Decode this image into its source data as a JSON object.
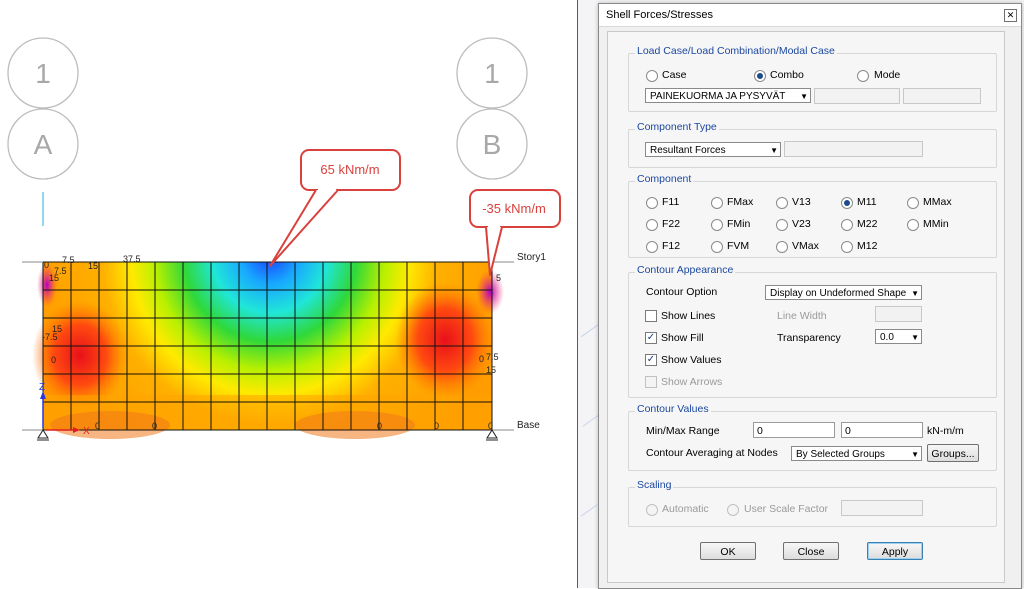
{
  "viewport": {
    "grid_bubbles": [
      {
        "id": "bubble-1-left",
        "text": "1"
      },
      {
        "id": "bubble-a",
        "text": "A"
      },
      {
        "id": "bubble-1-right",
        "text": "1"
      },
      {
        "id": "bubble-b",
        "text": "B"
      }
    ],
    "callouts": {
      "center": "65 kNm/m",
      "right": "-35 kNm/m"
    },
    "story_labels": {
      "top": "Story1",
      "bottom": "Base"
    },
    "contour_values": [
      {
        "text": "0"
      },
      {
        "text": "7.5"
      },
      {
        "text": "7.5"
      },
      {
        "text": "15"
      },
      {
        "text": "15"
      },
      {
        "text": "37.5"
      },
      {
        "text": "15"
      },
      {
        "text": "-7.5"
      },
      {
        "text": "0"
      },
      {
        "text": "5"
      },
      {
        "text": "0"
      },
      {
        "text": "7.5"
      },
      {
        "text": "15"
      },
      {
        "text": "0"
      },
      {
        "text": "0"
      },
      {
        "text": "0"
      },
      {
        "text": "0"
      },
      {
        "text": "0"
      }
    ],
    "axis_labels": {
      "z": "Z",
      "x": "X"
    },
    "colors": {
      "callout_border": "#d9413c",
      "callout_text": "#d9413c",
      "grid_bubble": "#bdbdbd"
    }
  },
  "dialog": {
    "title": "Shell Forces/Stresses",
    "close_icon": "close-icon",
    "load_case": {
      "title": "Load Case/Load Combination/Modal Case",
      "options": [
        {
          "label": "Case",
          "selected": false
        },
        {
          "label": "Combo",
          "selected": true
        },
        {
          "label": "Mode",
          "selected": false
        }
      ],
      "combo_value": "PAINEKUORMA JA PYSYVÄT"
    },
    "component_type": {
      "title": "Component Type",
      "value": "Resultant Forces"
    },
    "component": {
      "title": "Component",
      "options": [
        {
          "label": "F11",
          "selected": false
        },
        {
          "label": "FMax",
          "selected": false
        },
        {
          "label": "V13",
          "selected": false
        },
        {
          "label": "M11",
          "selected": true
        },
        {
          "label": "MMax",
          "selected": false
        },
        {
          "label": "F22",
          "selected": false
        },
        {
          "label": "FMin",
          "selected": false
        },
        {
          "label": "V23",
          "selected": false
        },
        {
          "label": "M22",
          "selected": false
        },
        {
          "label": "MMin",
          "selected": false
        },
        {
          "label": "F12",
          "selected": false
        },
        {
          "label": "FVM",
          "selected": false
        },
        {
          "label": "VMax",
          "selected": false
        },
        {
          "label": "M12",
          "selected": false
        }
      ]
    },
    "contour_appearance": {
      "title": "Contour Appearance",
      "contour_option_label": "Contour Option",
      "contour_option_value": "Display on Undeformed Shape",
      "show_lines": {
        "label": "Show Lines",
        "checked": false
      },
      "show_fill": {
        "label": "Show Fill",
        "checked": true
      },
      "show_values": {
        "label": "Show Values",
        "checked": true
      },
      "show_arrows": {
        "label": "Show Arrows",
        "checked": false,
        "disabled": true
      },
      "line_width_label": "Line Width",
      "transparency_label": "Transparency",
      "transparency_value": "0.0"
    },
    "contour_values": {
      "title": "Contour Values",
      "range_label": "Min/Max Range",
      "min": "0",
      "max": "0",
      "units": "kN-m/m",
      "averaging_label": "Contour Averaging at Nodes",
      "averaging_value": "By Selected Groups",
      "groups_button": "Groups..."
    },
    "scaling": {
      "title": "Scaling",
      "automatic": "Automatic",
      "user_scale": "User Scale Factor"
    },
    "buttons": {
      "ok": "OK",
      "close": "Close",
      "apply": "Apply"
    }
  }
}
